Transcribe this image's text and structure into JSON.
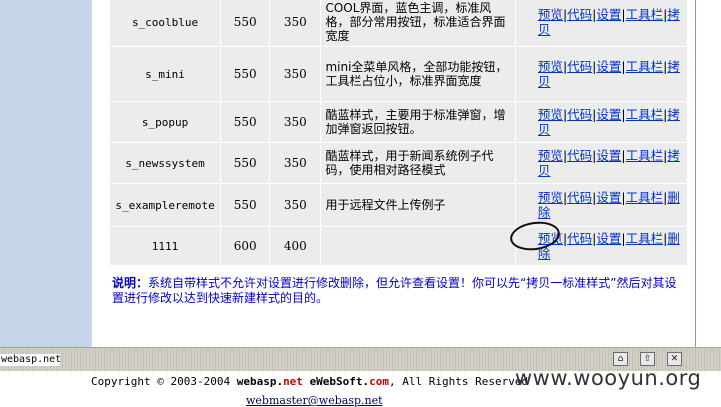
{
  "rows": [
    {
      "name": "s_coolblue",
      "width": "550",
      "height": "350",
      "desc": "COOL界面，蓝色主调，标准风格，部分常用按钮，标准适合界面宽度",
      "actions": [
        "预览",
        "代码",
        "设置",
        "工具栏",
        "拷贝"
      ]
    },
    {
      "name": "s_mini",
      "width": "550",
      "height": "350",
      "desc": "mini全菜单风格，全部功能按钮，工具栏占位小，标准界面宽度",
      "actions": [
        "预览",
        "代码",
        "设置",
        "工具栏",
        "拷贝"
      ]
    },
    {
      "name": "s_popup",
      "width": "550",
      "height": "350",
      "desc": "酷蓝样式，主要用于标准弹窗，增加弹窗返回按钮。",
      "actions": [
        "预览",
        "代码",
        "设置",
        "工具栏",
        "拷贝"
      ]
    },
    {
      "name": "s_newssystem",
      "width": "550",
      "height": "350",
      "desc": "酷蓝样式，用于新闻系统例子代码，使用相对路径模式",
      "actions": [
        "预览",
        "代码",
        "设置",
        "工具栏",
        "拷贝"
      ]
    },
    {
      "name": "s_exampleremote",
      "width": "550",
      "height": "350",
      "desc": "用于远程文件上传例子",
      "actions": [
        "预览",
        "代码",
        "设置",
        "工具栏",
        "删除"
      ]
    },
    {
      "name": "1111",
      "width": "600",
      "height": "400",
      "desc": "",
      "actions": [
        "预览",
        "代码",
        "设置",
        "工具栏",
        "删除"
      ]
    }
  ],
  "note": {
    "label": "说明：",
    "text": "系统自带样式不允许对设置进行修改删除，但允许查看设置！你可以先“拷贝一标准样式”然后对其设置进行修改以达到快速新建样式的目的。"
  },
  "status_bar": {
    "left_text": "webasp.net",
    "buttons": [
      "home-icon",
      "up-icon",
      "close-icon"
    ]
  },
  "footer": {
    "copyright_prefix": "Copyright © 2003-2004 ",
    "brand1": "webasp.",
    "brand1_tld": "net",
    "brand2": "eWebSoft.",
    "brand2_tld": "com",
    "rights": ", All Rights Reserved .",
    "email": "webmaster@webasp.net"
  },
  "watermark": "www.wooyun.org"
}
